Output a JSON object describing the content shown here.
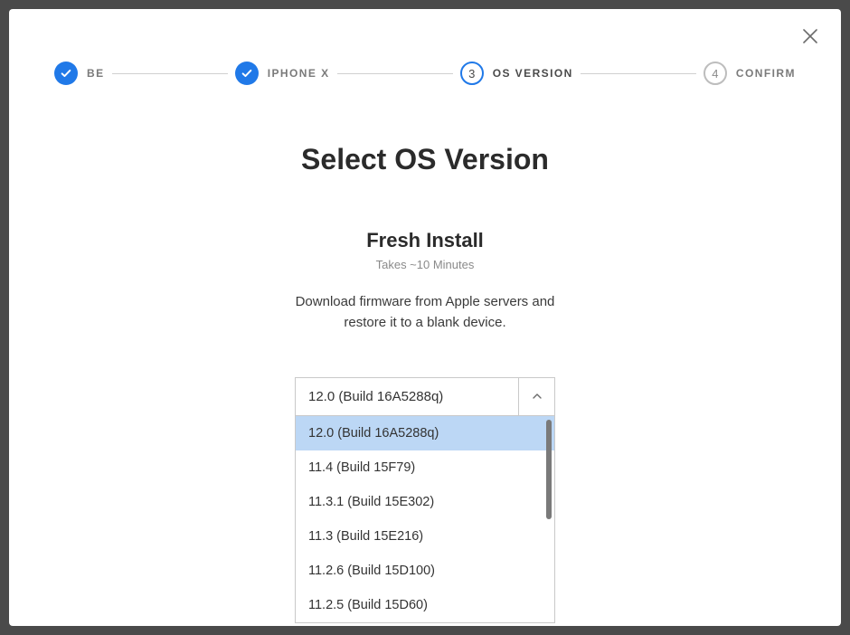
{
  "stepper": {
    "steps": [
      {
        "label": "BE",
        "state": "done"
      },
      {
        "label": "IPHONE X",
        "state": "done"
      },
      {
        "label": "OS VERSION",
        "state": "current",
        "number": "3"
      },
      {
        "label": "CONFIRM",
        "state": "pending",
        "number": "4"
      }
    ]
  },
  "heading": "Select OS Version",
  "section": {
    "title": "Fresh Install",
    "note": "Takes ~10 Minutes",
    "description_line1": "Download firmware from Apple servers and",
    "description_line2": "restore it to a blank device."
  },
  "dropdown": {
    "selected": "12.0 (Build 16A5288q)",
    "options": [
      "12.0 (Build 16A5288q)",
      "11.4 (Build 15F79)",
      "11.3.1 (Build 15E302)",
      "11.3 (Build 15E216)",
      "11.2.6 (Build 15D100)",
      "11.2.5 (Build 15D60)"
    ]
  }
}
